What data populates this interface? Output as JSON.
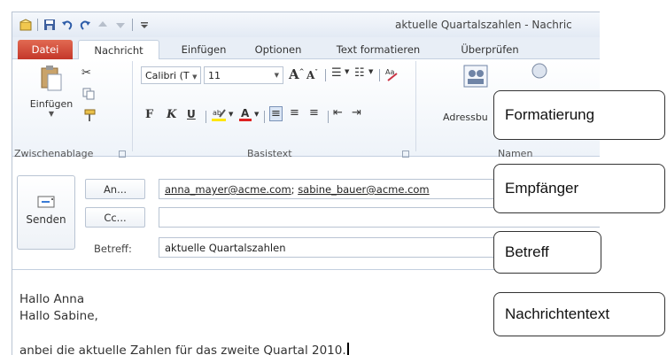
{
  "window": {
    "title": "aktuelle Quartalszahlen - Nachric"
  },
  "tabs": [
    "Datei",
    "Nachricht",
    "Einfügen",
    "Optionen",
    "Text formatieren",
    "Überprüfen"
  ],
  "ribbon": {
    "clipboard": {
      "paste_label": "Einfügen",
      "group_label": "Zwischenablage"
    },
    "basictext": {
      "font_name": "Calibri (T",
      "font_size": "11",
      "bold": "F",
      "italic": "K",
      "underline": "U",
      "group_label": "Basistext"
    },
    "names": {
      "address_book_label": "Adressbu",
      "group_label": "Namen"
    }
  },
  "header": {
    "send_label": "Senden",
    "to_button": "An...",
    "cc_button": "Cc...",
    "subject_label": "Betreff:",
    "to_value_1": "anna_mayer@acme.com",
    "to_separator": "; ",
    "to_value_2": "sabine_bauer@acme.com",
    "cc_value": "",
    "subject_value": "aktuelle Quartalszahlen"
  },
  "body": {
    "lines": [
      "Hallo Anna",
      "Hallo Sabine,",
      "",
      "anbei die aktuelle Zahlen für das zweite Quartal 2010."
    ]
  },
  "callouts": {
    "formatting": "Formatierung",
    "recipient": "Empfänger",
    "subject": "Betreff",
    "message_text": "Nachrichtentext"
  },
  "colors": {
    "file_tab": "#c4372a",
    "border": "#b9c4d3"
  }
}
